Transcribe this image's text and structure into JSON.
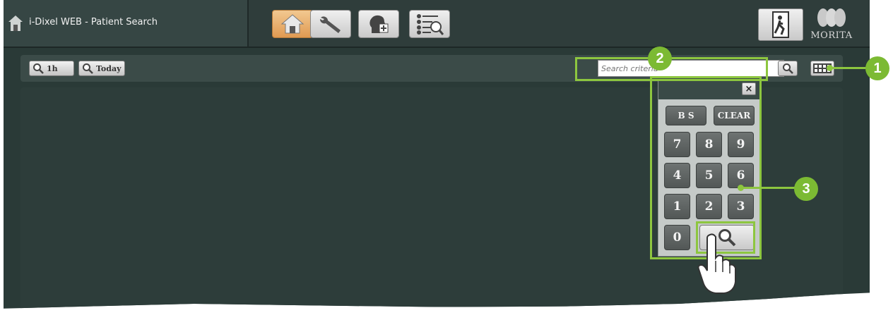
{
  "titlebar": {
    "title": "i-Dixel WEB - Patient Search",
    "nav_icons": [
      "home-icon",
      "wrench-icon",
      "add-patient-icon",
      "list-search-icon"
    ],
    "active_nav": "home-icon",
    "exit_icon": "exit-door-icon",
    "logo_text": "MORITA"
  },
  "toolbar": {
    "btn_1h": "1h",
    "btn_today": "Today",
    "search_placeholder": "Search criteria"
  },
  "keypad": {
    "bs": "B S",
    "clear": "CLEAR",
    "close": "×",
    "digits": [
      "7",
      "8",
      "9",
      "4",
      "5",
      "6",
      "1",
      "2",
      "3",
      "0"
    ]
  },
  "callouts": [
    "1",
    "2",
    "3"
  ],
  "colors": {
    "background": "#2a3a37",
    "callout_green": "#8dc63f",
    "active_nav": "#e09a52"
  }
}
